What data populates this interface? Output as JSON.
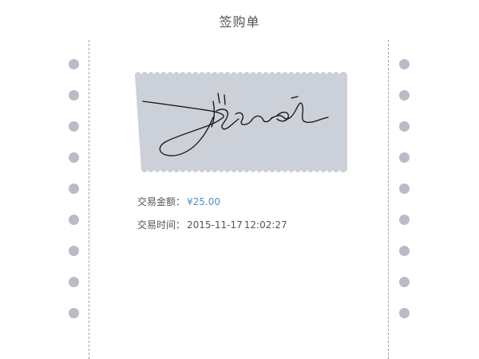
{
  "header": {
    "title": "签购单"
  },
  "receipt": {
    "amount_label": "交易金额：",
    "amount_value": "¥25.00",
    "time_label": "交易时间：",
    "time_date": "2015-11-17",
    "time_clock": "12:02:27"
  },
  "colors": {
    "signature_bg": "#ccd0d8",
    "amount": "#4a90c8",
    "perforation_dot": "#b9bcc6"
  }
}
